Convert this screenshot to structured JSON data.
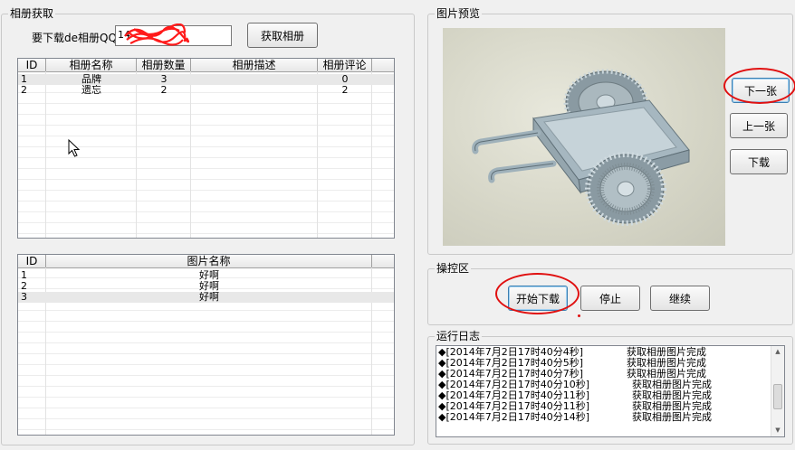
{
  "album_group": {
    "title": "相册获取",
    "qq_label": "要下载de相册QQ:",
    "qq_value": "14",
    "fetch_button": "获取相册"
  },
  "album_table": {
    "headers": [
      "ID",
      "相册名称",
      "相册数量",
      "相册描述",
      "相册评论"
    ],
    "rows": [
      [
        "1",
        "品牌",
        "3",
        "",
        "0"
      ],
      [
        "2",
        "遗忘",
        "2",
        "",
        "2"
      ]
    ]
  },
  "photo_table": {
    "headers": [
      "ID",
      "图片名称"
    ],
    "rows": [
      [
        "1",
        "好啊"
      ],
      [
        "2",
        "好啊"
      ],
      [
        "3",
        "好啊"
      ]
    ]
  },
  "preview_group": {
    "title": "图片预览",
    "next_button": "下一张",
    "prev_button": "上一张",
    "download_button": "下载"
  },
  "control_group": {
    "title": "操控区",
    "start_button": "开始下载",
    "stop_button": "停止",
    "continue_button": "继续"
  },
  "log_group": {
    "title": "运行日志",
    "lines": [
      {
        "time": "◆[2014年7月2日17时40分4秒]",
        "msg": "获取相册图片完成"
      },
      {
        "time": "◆[2014年7月2日17时40分5秒]",
        "msg": "获取相册图片完成"
      },
      {
        "time": "◆[2014年7月2日17时40分7秒]",
        "msg": "获取相册图片完成"
      },
      {
        "time": "◆[2014年7月2日17时40分10秒]",
        "msg": "获取相册图片完成"
      },
      {
        "time": "◆[2014年7月2日17时40分11秒]",
        "msg": "获取相册图片完成"
      },
      {
        "time": "◆[2014年7月2日17时40分11秒]",
        "msg": "获取相册图片完成"
      },
      {
        "time": "◆[2014年7月2日17时40分14秒]",
        "msg": "获取相册图片完成"
      }
    ]
  },
  "colors": {
    "annotation_ring": "#e01010",
    "preview_background": "#d8d8c8",
    "cart_body": "#b8c8d0"
  }
}
